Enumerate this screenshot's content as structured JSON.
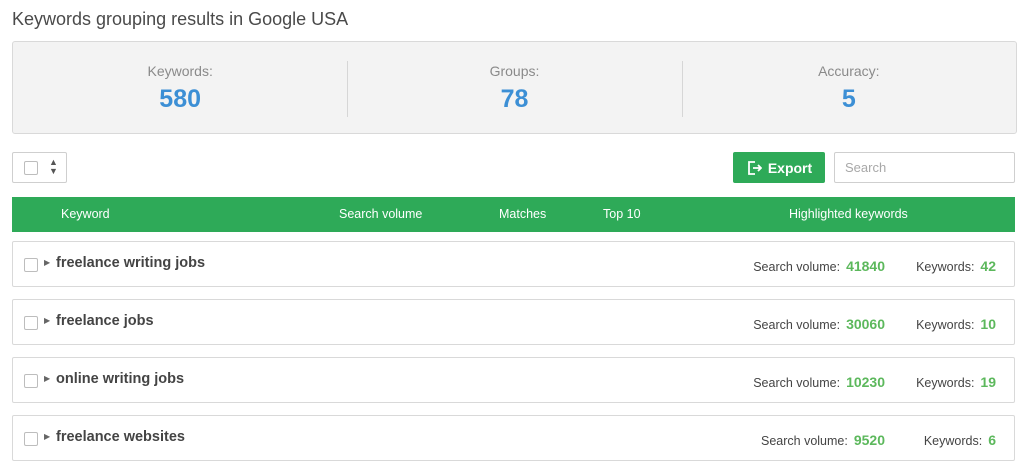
{
  "page_title": "Keywords grouping results in Google USA",
  "stats": [
    {
      "label": "Keywords:",
      "value": "580"
    },
    {
      "label": "Groups:",
      "value": "78"
    },
    {
      "label": "Accuracy:",
      "value": "5"
    }
  ],
  "toolbar": {
    "export_label": "Export",
    "search_placeholder": "Search"
  },
  "table": {
    "headers": {
      "keyword": "Keyword",
      "search_volume": "Search volume",
      "matches": "Matches",
      "top10": "Top 10",
      "highlighted": "Highlighted keywords"
    },
    "row_labels": {
      "volume": "Search volume:",
      "keywords": "Keywords:"
    },
    "rows": [
      {
        "keyword": "freelance writing jobs",
        "volume": "41840",
        "keywords": "42"
      },
      {
        "keyword": "freelance jobs",
        "volume": "30060",
        "keywords": "10"
      },
      {
        "keyword": "online writing jobs",
        "volume": "10230",
        "keywords": "19"
      },
      {
        "keyword": "freelance websites",
        "volume": "9520",
        "keywords": "6"
      }
    ]
  },
  "colors": {
    "accent_green": "#2eaa58",
    "stat_blue": "#3c8fd5",
    "value_green": "#5cb85c"
  },
  "icons": {
    "export": "export-icon",
    "caret": "caret-right-icon",
    "sort": "sort-arrows-icon"
  }
}
